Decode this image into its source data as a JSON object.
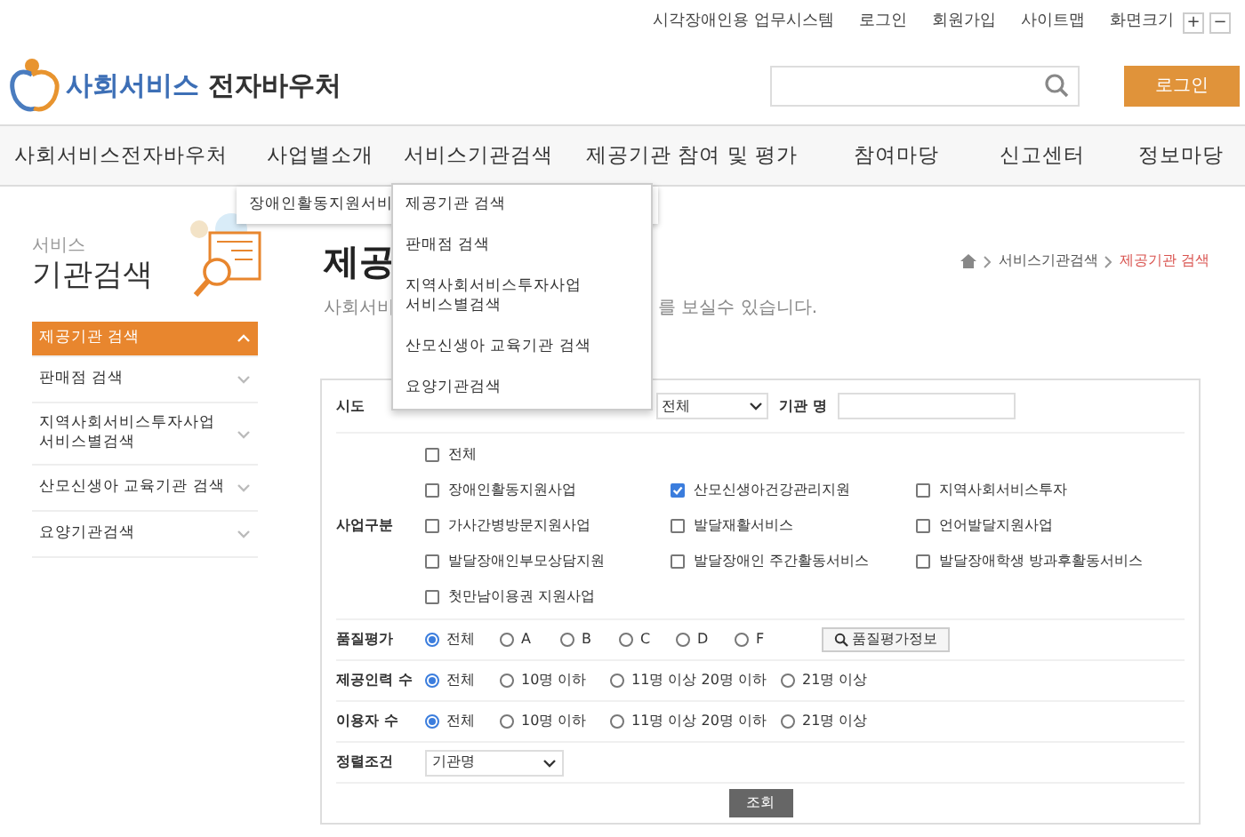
{
  "top_links": [
    "시각장애인용 업무시스템",
    "로그인",
    "회원가입",
    "사이트맵"
  ],
  "font_size": {
    "label": "화면크기",
    "buttons": [
      "+",
      "−"
    ]
  },
  "logo": {
    "text_1": "사회서비스",
    "text_2": "전자바우처"
  },
  "login_button": "로그인",
  "nav": [
    "사회서비스전자바우처",
    "사업별소개",
    "서비스기관검색",
    "제공기관 참여 및 평가",
    "참여마당",
    "신고센터",
    "정보마당"
  ],
  "submenu": {
    "items": [
      "장애인활동지원서비"
    ]
  },
  "dropdown": {
    "items": [
      "제공기관 검색",
      "판매점 검색",
      "지역사회서비스투자사업\n서비스별검색",
      "산모신생아 교육기관 검색",
      "요양기관검색"
    ]
  },
  "sidebar": {
    "subtitle": "서비스",
    "title": "기관검색",
    "items": [
      {
        "label": "제공기관 검색",
        "selected": true
      },
      {
        "label": "판매점 검색",
        "selected": false
      },
      {
        "label": "지역사회서비스투자사업\n서비스별검색",
        "selected": false
      },
      {
        "label": "산모신생아 교육기관 검색",
        "selected": false
      },
      {
        "label": "요양기관검색",
        "selected": false
      }
    ]
  },
  "page": {
    "title": "제공",
    "breadcrumb": [
      "서비스기관검색",
      "제공기관 검색"
    ],
    "subtitle_parts": [
      "사회서비",
      "를 보실수 있습니다."
    ]
  },
  "form": {
    "region": {
      "label": "시도",
      "select": "전체",
      "name_label": "기관 명"
    },
    "business": {
      "label": "사업구분",
      "options": [
        {
          "label": "전체",
          "checked": false
        },
        {
          "label": "장애인활동지원사업",
          "checked": false
        },
        {
          "label": "산모신생아건강관리지원",
          "checked": true
        },
        {
          "label": "지역사회서비스투자",
          "checked": false
        },
        {
          "label": "가사간병방문지원사업",
          "checked": false
        },
        {
          "label": "발달재활서비스",
          "checked": false
        },
        {
          "label": "언어발달지원사업",
          "checked": false
        },
        {
          "label": "발달장애인부모상담지원",
          "checked": false
        },
        {
          "label": "발달장애인 주간활동서비스",
          "checked": false
        },
        {
          "label": "발달장애학생 방과후활동서비스",
          "checked": false
        },
        {
          "label": "첫만남이용권 지원사업",
          "checked": false
        }
      ]
    },
    "radio_groups": [
      {
        "label": "품질평가",
        "button": "품질평가정보",
        "options": [
          {
            "label": "전체",
            "selected": true
          },
          {
            "label": "A",
            "selected": false
          },
          {
            "label": "B",
            "selected": false
          },
          {
            "label": "C",
            "selected": false
          },
          {
            "label": "D",
            "selected": false
          },
          {
            "label": "F",
            "selected": false
          }
        ]
      },
      {
        "label": "제공인력 수",
        "options": [
          {
            "label": "전체",
            "selected": true
          },
          {
            "label": "10명 이하",
            "selected": false
          },
          {
            "label": "11명 이상 20명 이하",
            "selected": false
          },
          {
            "label": "21명 이상",
            "selected": false
          }
        ]
      },
      {
        "label": "이용자 수",
        "options": [
          {
            "label": "전체",
            "selected": true
          },
          {
            "label": "10명 이하",
            "selected": false
          },
          {
            "label": "11명 이상 20명 이하",
            "selected": false
          },
          {
            "label": "21명 이상",
            "selected": false
          }
        ]
      }
    ],
    "sort": {
      "label": "정렬조건",
      "value": "기관명"
    },
    "submit": "조회"
  }
}
